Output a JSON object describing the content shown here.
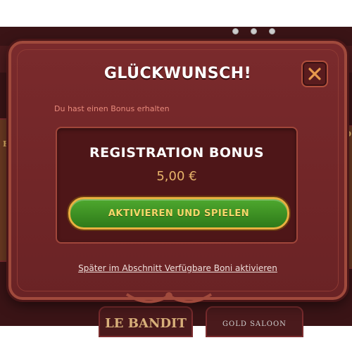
{
  "modal": {
    "title": "GLÜCKWUNSCH!",
    "subtitle": "Du hast einen Bonus erhalten",
    "close_icon": "close-icon",
    "bonus": {
      "name": "REGISTRATION BONUS",
      "amount": "5,00 €"
    },
    "activate_label": "AKTIVIEREN UND SPIELEN",
    "later_link": "Später im Abschnitt Verfügbare Boni aktivieren"
  },
  "background": {
    "bottom_games": [
      "LE BANDIT",
      "GOLD SALOON"
    ],
    "left_side_text": "BO",
    "right_side_text": "BO"
  },
  "colors": {
    "modal_bg": "#6a2325",
    "accent_gold": "#e6b36a",
    "button_green": "#3a8e22",
    "subtitle_red": "#e88a7c"
  }
}
